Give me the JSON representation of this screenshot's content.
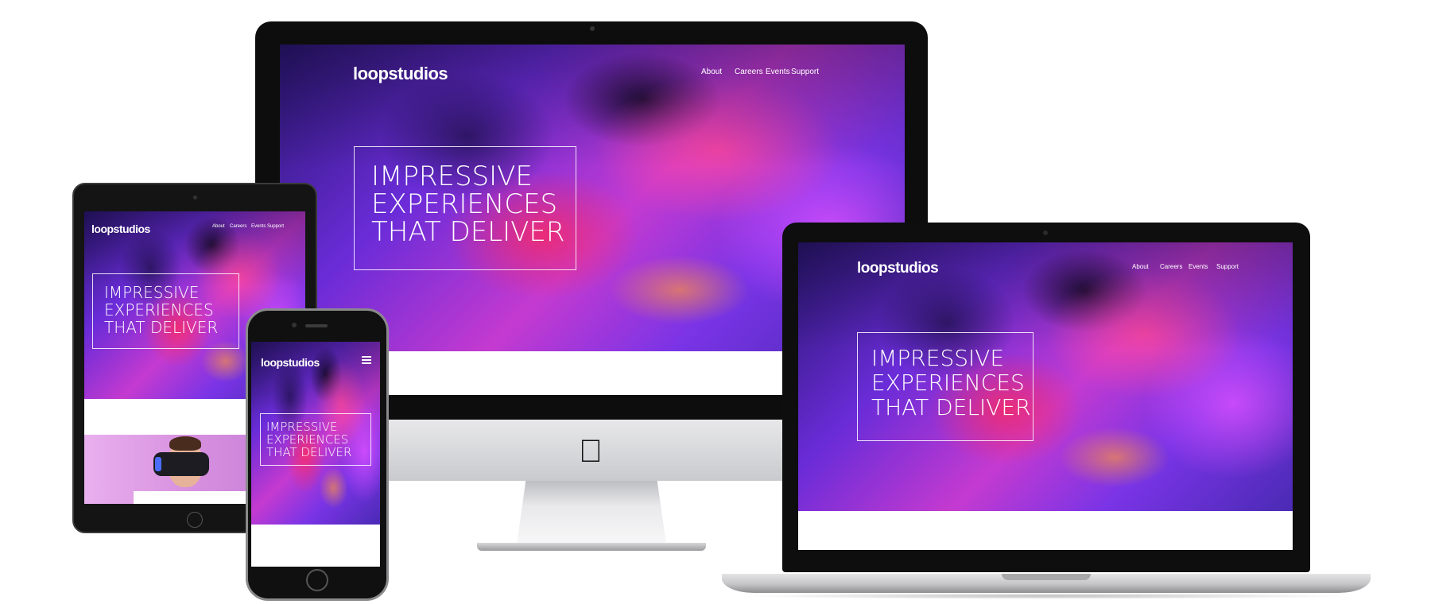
{
  "site": {
    "logo": "loopstudios",
    "nav": [
      "About",
      "Careers",
      "Events",
      "Support"
    ],
    "hero_lines": [
      "IMPRESSIVE",
      "EXPERIENCES",
      "THAT DELIVER"
    ]
  },
  "icons": {
    "apple_logo": "apple-logo-icon",
    "mobile_menu": "hamburger-menu-icon"
  },
  "colors": {
    "hero_violet": "#6a2cd8",
    "hero_magenta": "#c43ad0",
    "device_black": "#0d0d0d",
    "device_silver": "#c9cacd"
  }
}
